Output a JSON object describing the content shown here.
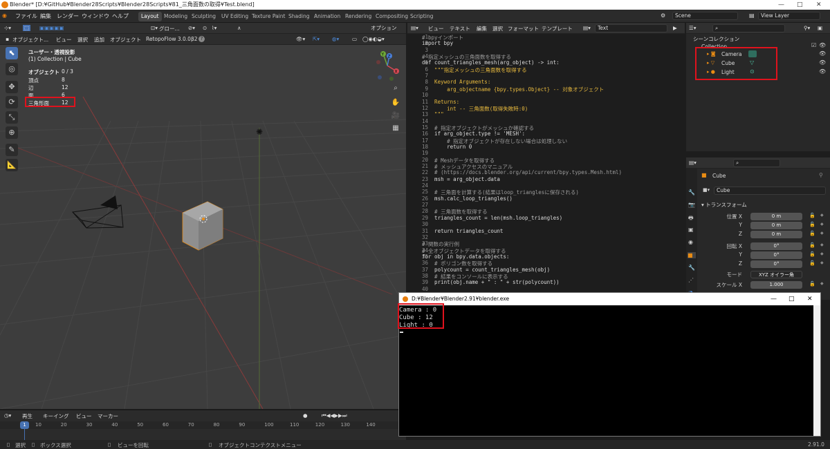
{
  "window": {
    "title": "Blender* [D:¥GitHub¥Blender28Scripts¥Blender28Scripts¥81_三角面数の取得¥Test.blend]",
    "min": "—",
    "max": "□",
    "close": "✕"
  },
  "menu": [
    "ファイル",
    "編集",
    "レンダー",
    "ウィンドウ",
    "ヘルプ"
  ],
  "workspaces": [
    "Layout",
    "Modeling",
    "Sculpting",
    "UV Editing",
    "Texture Paint",
    "Shading",
    "Animation",
    "Rendering",
    "Compositing",
    "Scripting"
  ],
  "scene": "Scene",
  "view_layer": "View Layer",
  "viewport": {
    "mode": "オブジェクト...",
    "menus": [
      "ビュー",
      "選択",
      "追加",
      "オブジェクト"
    ],
    "addon": "RetopoFlow 3.0.0β2",
    "pivot": "グロー...",
    "options": "オプション",
    "overlay": {
      "title": "ユーザー・透視投影",
      "collection": "(1) Collection | Cube"
    },
    "stats": [
      {
        "label": "オブジェクト",
        "value": "0 / 3"
      },
      {
        "label": "頂点",
        "value": "8"
      },
      {
        "label": "辺",
        "value": "12"
      },
      {
        "label": "面",
        "value": "6"
      },
      {
        "label": "三角形面",
        "value": "12"
      }
    ],
    "gizmo": {
      "y": "Y",
      "x": "X",
      "z": "Z"
    }
  },
  "text_editor": {
    "menus": [
      "ビュー",
      "テキスト",
      "編集",
      "選択",
      "フォーマット",
      "テンプレート"
    ],
    "filename": "Text",
    "lines": [
      {
        "n": "1",
        "t": "# bpyインポート",
        "c": "cm"
      },
      {
        "n": "2",
        "t": "import bpy",
        "c": ""
      },
      {
        "n": "3",
        "t": "",
        "c": ""
      },
      {
        "n": "4",
        "t": "# 指定メッシュの三角面数を取得する",
        "c": "cm"
      },
      {
        "n": "5",
        "t": "def count_triangles_mesh(arg_object) -> int:",
        "c": ""
      },
      {
        "n": "6",
        "t": "    \"\"\"指定メッシュの三角面数を取得する",
        "c": "st"
      },
      {
        "n": "7",
        "t": "",
        "c": ""
      },
      {
        "n": "8",
        "t": "    Keyword Arguments:",
        "c": "st"
      },
      {
        "n": "9",
        "t": "        arg_objectname {bpy.types.Object} -- 対象オブジェクト",
        "c": "st"
      },
      {
        "n": "10",
        "t": "",
        "c": ""
      },
      {
        "n": "11",
        "t": "    Returns:",
        "c": "st"
      },
      {
        "n": "12",
        "t": "        int -- 三角面数(取得失敗時:0)",
        "c": "st"
      },
      {
        "n": "13",
        "t": "    \"\"\"",
        "c": "st"
      },
      {
        "n": "14",
        "t": "",
        "c": ""
      },
      {
        "n": "15",
        "t": "    # 指定オブジェクトがメッシュか確認する",
        "c": "cm"
      },
      {
        "n": "16",
        "t": "    if arg_object.type != 'MESH':",
        "c": ""
      },
      {
        "n": "17",
        "t": "        # 指定オブジェクトが存在しない場合は処理しない",
        "c": "cm"
      },
      {
        "n": "18",
        "t": "        return 0",
        "c": ""
      },
      {
        "n": "19",
        "t": "",
        "c": ""
      },
      {
        "n": "20",
        "t": "    # Meshデータを取得する",
        "c": "cm"
      },
      {
        "n": "21",
        "t": "    # メッシュアクセスのマニュアル",
        "c": "cm"
      },
      {
        "n": "22",
        "t": "    # (https://docs.blender.org/api/current/bpy.types.Mesh.html)",
        "c": "cm"
      },
      {
        "n": "23",
        "t": "    msh = arg_object.data",
        "c": ""
      },
      {
        "n": "24",
        "t": "",
        "c": ""
      },
      {
        "n": "25",
        "t": "    # 三角面を計算する(結果はloop_trianglesに保存される)",
        "c": "cm"
      },
      {
        "n": "26",
        "t": "    msh.calc_loop_triangles()",
        "c": ""
      },
      {
        "n": "27",
        "t": "",
        "c": ""
      },
      {
        "n": "28",
        "t": "    # 三角面数を取得する",
        "c": "cm"
      },
      {
        "n": "29",
        "t": "    triangles_count = len(msh.loop_triangles)",
        "c": ""
      },
      {
        "n": "30",
        "t": "",
        "c": ""
      },
      {
        "n": "31",
        "t": "    return triangles_count",
        "c": ""
      },
      {
        "n": "32",
        "t": "",
        "c": ""
      },
      {
        "n": "33",
        "t": "# 関数の実行例",
        "c": "cm"
      },
      {
        "n": "34",
        "t": "# 全オブジェクトデータを取得する",
        "c": "cm"
      },
      {
        "n": "35",
        "t": "for obj in bpy.data.objects:",
        "c": ""
      },
      {
        "n": "36",
        "t": "    # ポリゴン数を取得する",
        "c": "cm"
      },
      {
        "n": "37",
        "t": "    polycount = count_triangles_mesh(obj)",
        "c": ""
      },
      {
        "n": "38",
        "t": "    # 結果をコンソールに表示する",
        "c": "cm"
      },
      {
        "n": "39",
        "t": "    print(obj.name + \" : \" + str(polycount))",
        "c": ""
      },
      {
        "n": "40",
        "t": "",
        "c": ""
      }
    ]
  },
  "outliner": {
    "title": "シーンコレクション",
    "collection": "Collection",
    "items": [
      "Camera",
      "Cube",
      "Light"
    ]
  },
  "properties": {
    "object": "Cube",
    "data": "Cube",
    "section": "トランスフォーム",
    "rows": [
      {
        "label": "位置 X",
        "value": "0 m"
      },
      {
        "label": "Y",
        "value": "0 m"
      },
      {
        "label": "Z",
        "value": "0 m"
      },
      {
        "label": "回転 X",
        "value": "0°"
      },
      {
        "label": "Y",
        "value": "0°"
      },
      {
        "label": "Z",
        "value": "0°"
      },
      {
        "label": "モード",
        "value": "XYZ オイラー角"
      },
      {
        "label": "スケール X",
        "value": "1.000"
      }
    ]
  },
  "timeline": {
    "menus": [
      "再生",
      "キーイング",
      "ビュー",
      "マーカー"
    ],
    "current": "1",
    "ticks": [
      "1",
      "10",
      "20",
      "30",
      "40",
      "50",
      "60",
      "70",
      "80",
      "90",
      "100",
      "110",
      "120",
      "130",
      "140"
    ]
  },
  "statusbar": {
    "left": "選択",
    "box": "ボックス選択",
    "rotate": "ビューを回転",
    "context": "オブジェクトコンテクストメニュー",
    "version": "2.91.0"
  },
  "console": {
    "title": "D:¥Blender¥Blender2.91¥blender.exe",
    "lines": [
      "Camera : 0",
      "Cube : 12",
      "Light : 0"
    ]
  }
}
